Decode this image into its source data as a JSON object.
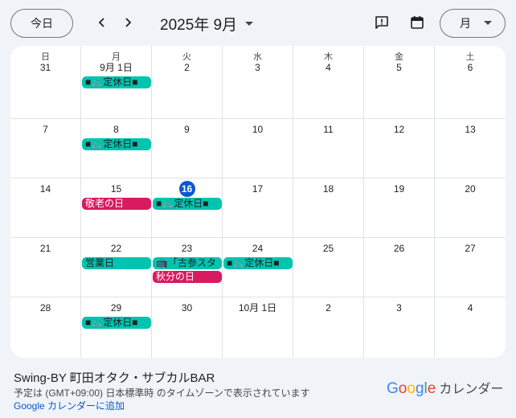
{
  "toolbar": {
    "today_label": "今日",
    "month_title": "2025年 9月",
    "view_label": "月"
  },
  "icons": {
    "prev": "chevron-left-icon",
    "next": "chevron-right-icon",
    "dropdown": "caret-down-icon",
    "feedback": "feedback-icon",
    "calendar": "calendar-icon"
  },
  "colors": {
    "teal": "#00c4b0",
    "crimson": "#d81b60",
    "today_blue": "#0b57d0"
  },
  "weekdays": [
    "日",
    "月",
    "火",
    "水",
    "木",
    "金",
    "土"
  ],
  "weeks": [
    [
      "31",
      "9月 1日",
      "2",
      "3",
      "4",
      "5",
      "6"
    ],
    [
      "7",
      "8",
      "9",
      "10",
      "11",
      "12",
      "13"
    ],
    [
      "14",
      "15",
      "16",
      "17",
      "18",
      "19",
      "20"
    ],
    [
      "21",
      "22",
      "23",
      "24",
      "25",
      "26",
      "27"
    ],
    [
      "28",
      "29",
      "30",
      "10月 1日",
      "2",
      "3",
      "4"
    ]
  ],
  "today": {
    "week": 2,
    "day": 2
  },
  "events": [
    {
      "week": 0,
      "day": 1,
      "slot": 0,
      "span": 1,
      "color": "teal",
      "title": "■🚲定休日■"
    },
    {
      "week": 1,
      "day": 1,
      "slot": 0,
      "span": 1,
      "color": "teal",
      "title": "■🚲定休日■"
    },
    {
      "week": 2,
      "day": 1,
      "slot": 0,
      "span": 1,
      "color": "crimson",
      "title": "敬老の日"
    },
    {
      "week": 2,
      "day": 2,
      "slot": 0,
      "span": 1,
      "color": "teal",
      "title": "■🚲定休日■"
    },
    {
      "week": 3,
      "day": 1,
      "slot": 0,
      "span": 1,
      "color": "teal",
      "title": "営業日"
    },
    {
      "week": 3,
      "day": 2,
      "slot": 0,
      "span": 1,
      "color": "teal",
      "title": "📺「古参スタ"
    },
    {
      "week": 3,
      "day": 3,
      "slot": 0,
      "span": 1,
      "color": "teal",
      "title": "■🚲定休日■"
    },
    {
      "week": 3,
      "day": 2,
      "slot": 1,
      "span": 1,
      "color": "crimson",
      "title": "秋分の日"
    },
    {
      "week": 4,
      "day": 1,
      "slot": 0,
      "span": 1,
      "color": "teal",
      "title": "■🚲定休日■"
    }
  ],
  "footer": {
    "calendar_name": "Swing-BY 町田オタク・サブカルBAR",
    "timezone_note": "予定は (GMT+09:00) 日本標準時 のタイムゾーンで表示されています",
    "add_link": "Google カレンダーに追加",
    "brand_letters": [
      "G",
      "o",
      "o",
      "g",
      "l",
      "e"
    ],
    "brand_colors": [
      "#4285f4",
      "#ea4335",
      "#fbbc04",
      "#4285f4",
      "#34a853",
      "#ea4335"
    ],
    "brand_suffix": "カレンダー"
  }
}
